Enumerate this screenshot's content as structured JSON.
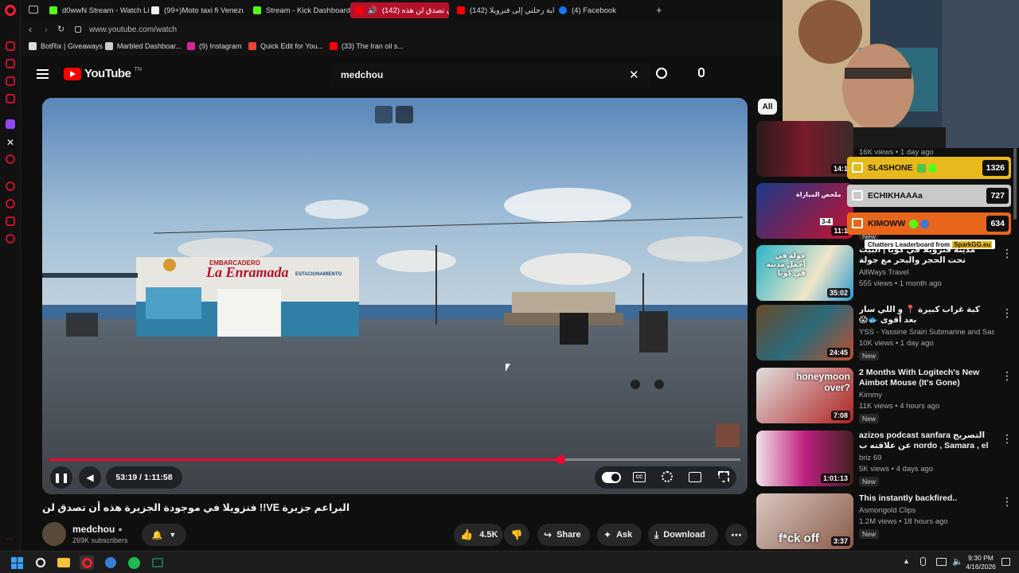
{
  "tabs": [
    {
      "label": "d0wwN Stream - Watch Li",
      "color": "#53fc18"
    },
    {
      "label": "(99+)Moto taxi fi Venezue",
      "color": "#ffffff"
    },
    {
      "label": "Stream - Kick Dashboard",
      "color": "#53fc18"
    },
    {
      "label": "(142) ان تصدق لن هذه",
      "color": "#ff0000"
    },
    {
      "label": "(142) بداية رحلتي إلى فنزويلا",
      "color": "#ff0000"
    },
    {
      "label": "(4) Facebook",
      "color": "#1877f2"
    }
  ],
  "new_tab_glyph": "+",
  "address": {
    "url": "www.youtube.com/watch"
  },
  "bookmarks": [
    {
      "label": "BotRix | Giveaways"
    },
    {
      "label": "Marbled Dashboar..."
    },
    {
      "label": "(9) Instagram"
    },
    {
      "label": "Quick Edit for You..."
    },
    {
      "label": "(33) The Iran oil s..."
    }
  ],
  "youtube": {
    "logo_text": "YouTube",
    "logo_sup": "TN",
    "search_value": "medchou",
    "filter_chip": "All"
  },
  "player": {
    "current_time": "53:19 / 1:11:58",
    "progress": 0.74,
    "video_title": "البراعم جزيرة VE!! فنزويلا في موجودة الجزيرة هذه أن تصدق لن",
    "sign_text": "La Enramada",
    "sign_top": "EMBARCADERO",
    "sign_right": "ESTACIONAMIENTO"
  },
  "channel": {
    "name": "medchou",
    "subscribers": "269K subscribers"
  },
  "actions": {
    "likes": "4.5K",
    "share": "Share",
    "ask": "Ask",
    "download": "Download"
  },
  "leaderboard": {
    "rows": [
      {
        "name": "SL4SHONE",
        "score": "1326",
        "bg": "#e8b91c",
        "color": "#111"
      },
      {
        "name": "ECHIKHAAAa",
        "score": "727",
        "bg": "#c9c9c9",
        "color": "#111"
      },
      {
        "name": "KIMOWW",
        "score": "634",
        "bg": "#e8661c",
        "color": "#111"
      }
    ],
    "footer": "Chatters Leaderboard from",
    "brand": "SparkGG.eu"
  },
  "recommendations": [
    {
      "title": "",
      "meta1": "16K views • 1 day ago",
      "meta2": "",
      "duration": "14:1",
      "badge": ""
    },
    {
      "title": "",
      "meta1": "",
      "meta2": "",
      "duration": "11:1",
      "badge": "New",
      "thumb_text": "ملخص المباراة",
      "score": "3-4"
    },
    {
      "title": "مدينة فنزويلا في كوبا | البيت تحت الحجر والبحر مع جولة بالباص المفتوح",
      "meta1": "AllWays Travel",
      "meta2": "555 views • 1 month ago",
      "duration": "35:02",
      "badge": "",
      "thumb_text": "جولة في أجمل مدينة في كوبا"
    },
    {
      "title": "كبة غراب كبيرة 📍 و اللي سار بعد أقوى 🐟😱",
      "meta1": "YSS - Yassine Srairi Submarine and Sash...",
      "meta2": "10K views • 1 day ago",
      "duration": "24:45",
      "badge": "New"
    },
    {
      "title": "2 Months With Logitech's New Aimbot Mouse (It's Gone)",
      "meta1": "Kimmy",
      "meta2": "11K views • 4 hours ago",
      "duration": "7:08",
      "badge": "New",
      "thumb_text": "honeymoon over?"
    },
    {
      "title": "azizos podcast sanfara التصريح عن علاقته ب nordo , Samara , el ...",
      "meta1": "briz 69",
      "meta2": "5K views • 4 days ago",
      "duration": "1:01:13",
      "badge": "New"
    },
    {
      "title": "This instantly backfired..",
      "meta1": "Asmongold Clips",
      "meta2": "1.2M views • 18 hours ago",
      "duration": "3:37",
      "badge": "New",
      "thumb_text": "f*ck off"
    }
  ],
  "clock": {
    "time": "9:30 PM",
    "date": "4/16/2026"
  },
  "colors": {
    "accent": "#ff0033",
    "bg": "#0f0f0f"
  }
}
